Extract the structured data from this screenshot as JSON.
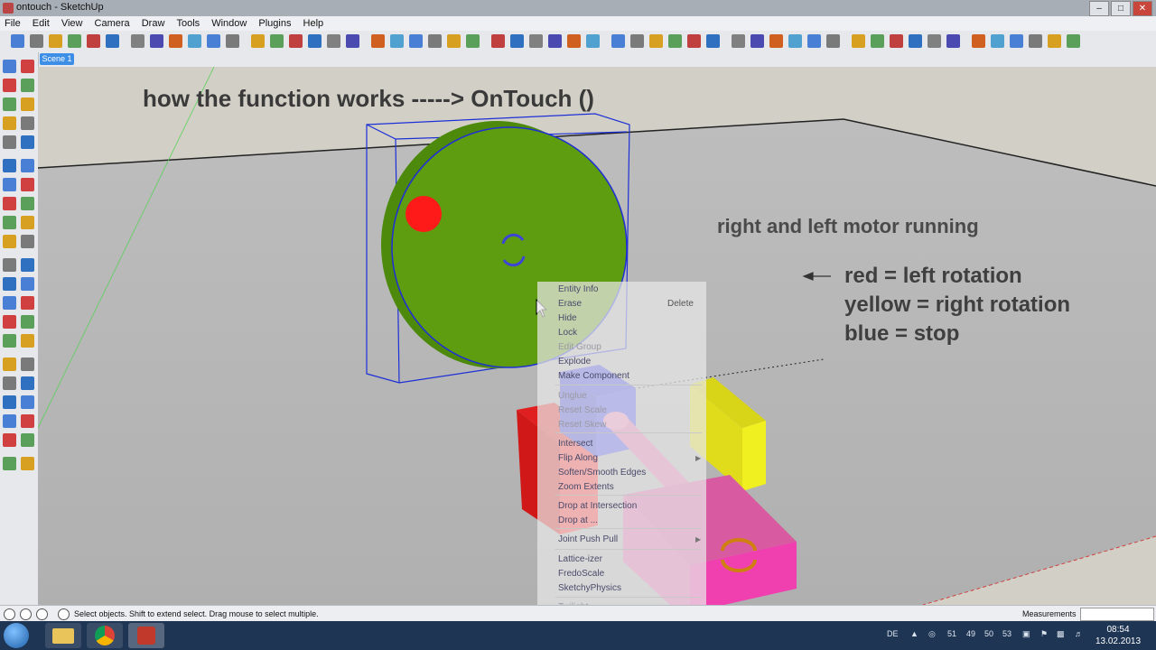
{
  "window": {
    "title": "ontouch - SketchUp"
  },
  "menu": [
    "File",
    "Edit",
    "View",
    "Camera",
    "Draw",
    "Tools",
    "Window",
    "Plugins",
    "Help"
  ],
  "scene_tab": "Scene 1",
  "viewport": {
    "heading": "how the function works -----> OnTouch ()",
    "motor_text": "right and left motor running",
    "legend": [
      "red = left rotation",
      "yellow = right rotation",
      "blue = stop"
    ]
  },
  "context_menu": {
    "items": [
      {
        "label": "Entity Info",
        "state": "normal"
      },
      {
        "label": "Erase",
        "state": "normal",
        "shortcut": "Delete"
      },
      {
        "label": "Hide",
        "state": "normal"
      },
      {
        "label": "Lock",
        "state": "normal"
      },
      {
        "label": "Edit Group",
        "state": "dim"
      },
      {
        "label": "Explode",
        "state": "normal"
      },
      {
        "label": "Make Component",
        "state": "normal"
      },
      {
        "label": "Unglue",
        "state": "dim"
      },
      {
        "label": "Reset Scale",
        "state": "dim"
      },
      {
        "label": "Reset Skew",
        "state": "dim"
      },
      {
        "label": "Intersect",
        "state": "normal"
      },
      {
        "label": "Flip Along",
        "state": "normal"
      },
      {
        "label": "Soften/Smooth Edges",
        "state": "normal"
      },
      {
        "label": "Zoom Extents",
        "state": "normal"
      },
      {
        "label": "Drop at Intersection",
        "state": "normal"
      },
      {
        "label": "Drop at ...",
        "state": "normal"
      },
      {
        "label": "Joint Push Pull",
        "state": "normal"
      },
      {
        "label": "Lattice-izer",
        "state": "normal"
      },
      {
        "label": "FredoScale",
        "state": "normal"
      },
      {
        "label": "SketchyPhysics",
        "state": "normal"
      },
      {
        "label": "Twilight",
        "state": "dim"
      }
    ]
  },
  "status": {
    "hint": "Select objects. Shift to extend select. Drag mouse to select multiple.",
    "measurements_label": "Measurements"
  },
  "taskbar": {
    "lang": "DE",
    "tray_numbers": [
      "51",
      "49",
      "50",
      "53"
    ],
    "time": "08:54",
    "date": "13.02.2013"
  },
  "colors": {
    "wheel": "#5e9c10",
    "red_dot": "#ff1a1a",
    "selection": "#1d2fd6",
    "block_red": "#ff2a2a",
    "block_blue": "#4a4af0",
    "block_yellow": "#f0ef20",
    "block_pink": "#f040b0",
    "shaft": "#e070a8"
  }
}
